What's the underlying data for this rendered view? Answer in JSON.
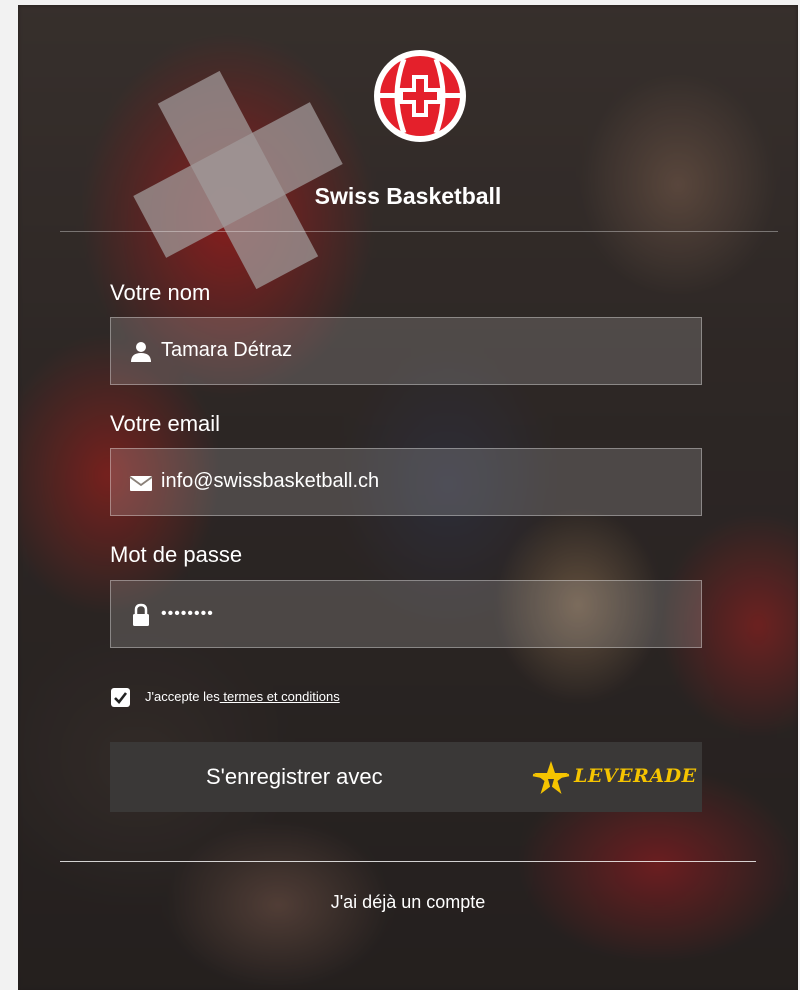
{
  "brand": {
    "name": "Swiss Basketball",
    "logo_icon": "swiss-basketball-logo",
    "accent": "#e4202b"
  },
  "form": {
    "name_label": "Votre nom",
    "name_value": "Tamara Détraz",
    "name_icon": "user-icon",
    "email_label": "Votre email",
    "email_value": "info@swissbasketball.ch",
    "email_icon": "envelope-icon",
    "password_label": "Mot de passe",
    "password_value": "••••••••",
    "password_icon": "lock-icon"
  },
  "terms": {
    "checked": true,
    "prefix": "J'accepte les",
    "link": " termes et conditions"
  },
  "signup": {
    "label": "S'enregistrer avec",
    "provider": "LEVERADE",
    "provider_color": "#f5c400"
  },
  "login_link": "J'ai déjà un compte"
}
